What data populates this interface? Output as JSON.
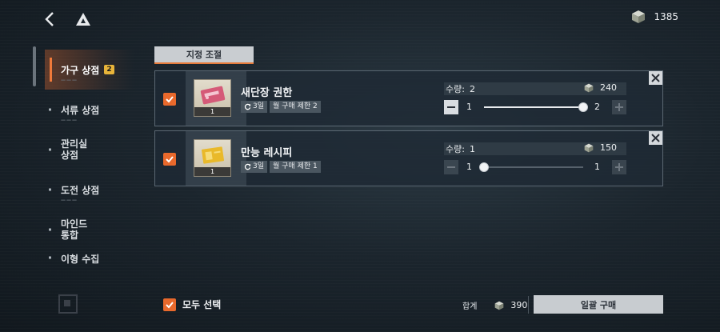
{
  "header": {
    "back_icon": "chevron-left-icon",
    "logo_icon": "triangle-logo-icon",
    "currency": {
      "icon": "cube-icon",
      "amount": "1385"
    }
  },
  "sidebar": {
    "items": [
      {
        "label": "가구 상점",
        "badge": "2",
        "active": true
      },
      {
        "label": "서류 상점",
        "badge": "",
        "active": false
      },
      {
        "label": "관리실\n상점",
        "badge": "",
        "active": false
      },
      {
        "label": "도전 상점",
        "badge": "",
        "active": false
      },
      {
        "label": "마인드\n통합",
        "badge": "",
        "active": false
      },
      {
        "label": "이형 수집",
        "badge": "",
        "active": false
      }
    ]
  },
  "tab": {
    "label": "지정 조절"
  },
  "cart": [
    {
      "name": "새단장 권한",
      "thumb_qty": "1",
      "tag_refresh": "3일",
      "tag_limit": "월 구매 제한 2",
      "qty_label": "수량:",
      "qty_value": "2",
      "price": "240",
      "min": "1",
      "max": "2",
      "minus_enabled": true,
      "plus_enabled": false,
      "slider_fraction": 1.0
    },
    {
      "name": "만능 레시피",
      "thumb_qty": "1",
      "tag_refresh": "3일",
      "tag_limit": "월 구매 제한 1",
      "qty_label": "수량:",
      "qty_value": "1",
      "price": "150",
      "min": "1",
      "max": "1",
      "minus_enabled": false,
      "plus_enabled": false,
      "slider_fraction": 0.0
    }
  ],
  "footer": {
    "select_all_label": "모두 선택",
    "total_label": "합계",
    "total_amount": "390",
    "buy_label": "일괄 구매"
  },
  "colors": {
    "accent": "#e9692c",
    "badge": "#e8b43a",
    "button": "#c8ccd0"
  }
}
